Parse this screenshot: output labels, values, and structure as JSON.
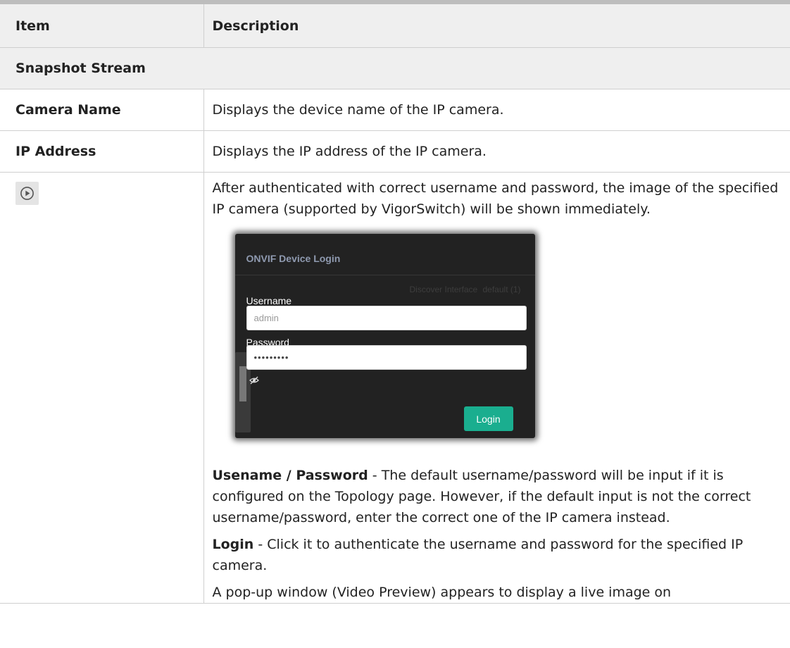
{
  "table": {
    "header": {
      "item": "Item",
      "description": "Description"
    },
    "section": "Snapshot Stream",
    "rows": [
      {
        "item": "Camera Name",
        "description": "Displays the device name of the IP camera."
      },
      {
        "item": "IP Address",
        "description": "Displays the IP address of the IP camera."
      }
    ],
    "play_row": {
      "icon": "play-circle-icon",
      "intro": "After authenticated with correct username and password, the image of the specified IP camera (supported by VigorSwitch) will be shown immediately.",
      "dialog": {
        "title": "ONVIF Device Login",
        "bg_interface_label": "Discover Interface",
        "bg_interface_value": "default (1)",
        "username_label": "Username",
        "username_value": "admin",
        "password_label": "Password",
        "password_value": "•••••••••",
        "toggle_icon": "eye-slash-icon",
        "login_label": "Login",
        "accent_color": "#1aae8f"
      },
      "term1": {
        "label": "Usename / Password",
        "text": " - The default username/password will be input if it is configured on the Topology page. However, if the default input is not the correct username/password, enter the correct one of the IP camera instead."
      },
      "term2": {
        "label": "Login",
        "text": " - Click it to authenticate the username and password for the specified IP camera."
      },
      "trailing": "A pop-up window (Video Preview) appears to display a live image on"
    }
  }
}
